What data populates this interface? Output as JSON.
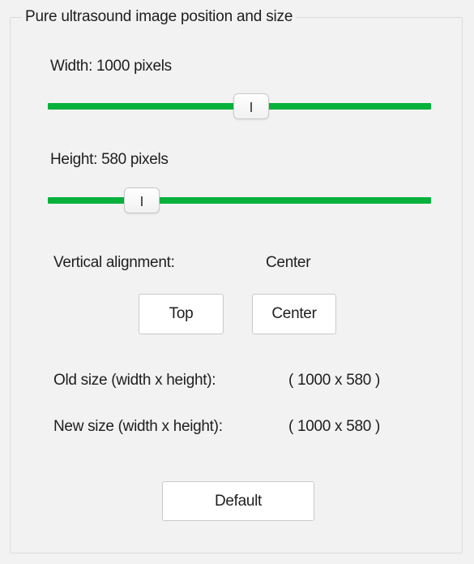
{
  "group": {
    "title": "Pure ultrasound image position and size"
  },
  "width_slider": {
    "label": "Width:  1000 pixels",
    "value_fraction": 0.53
  },
  "height_slider": {
    "label": "Height:  580 pixels",
    "value_fraction": 0.245
  },
  "alignment": {
    "label": "Vertical alignment:",
    "value": "Center",
    "top_button": "Top",
    "center_button": "Center"
  },
  "sizes": {
    "old_label": "Old size (width x height):",
    "old_value": "( 1000 x 580 )",
    "new_label": "New size (width x height):",
    "new_value": "( 1000 x 580 )"
  },
  "default_button": "Default",
  "colors": {
    "slider_track": "#07b13c",
    "background": "#f2f2f2"
  }
}
